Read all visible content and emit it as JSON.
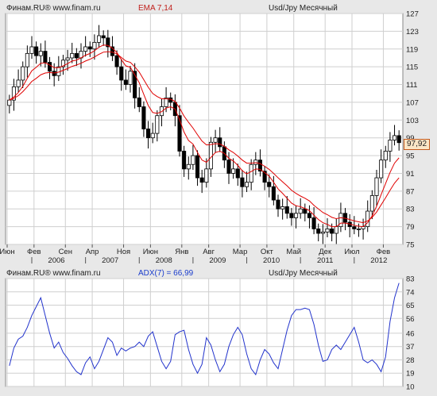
{
  "colors": {
    "background": "#e8e8e8",
    "plot_bg": "#ffffff",
    "grid": "#cfcfcf",
    "up_candle": "#ffffff",
    "down_candle": "#000000",
    "ema": "#e00000",
    "adx": "#2233cc",
    "price_tag_bg": "#fbe6c6",
    "price_tag_border": "#c25a1d"
  },
  "top_panel": {
    "source_label": "Финам.RU® www.finam.ru",
    "indicator_label": "EMA 7,14",
    "instrument_label": "Usd/Jpy Месячный",
    "last_price_label": "97,92"
  },
  "bottom_panel": {
    "source_label": "Финам.RU® www.finam.ru",
    "indicator_label": "ADX(7) = 66,99",
    "instrument_label": "Usd/Jpy Месячный"
  },
  "x_axis": {
    "month_labels": [
      "Июн",
      "Фев",
      "Сен",
      "Апр",
      "Ноя",
      "Июн",
      "Янв",
      "Авг",
      "Мар",
      "Окт",
      "Май",
      "Дек",
      "Июл",
      "Фев"
    ],
    "year_labels": [
      "2006",
      "2007",
      "2008",
      "2009",
      "2010",
      "2011",
      "2012"
    ]
  },
  "chart_data": [
    {
      "type": "candlestick",
      "title": "Usd/Jpy Месячный",
      "indicator": "EMA 7,14",
      "ylim": [
        75,
        127
      ],
      "y_ticks": [
        75,
        79,
        83,
        87,
        91,
        95,
        99,
        103,
        107,
        111,
        115,
        119,
        123,
        127
      ],
      "last_price": 97.92,
      "grid": true,
      "months": [
        "Июн",
        "Фев",
        "Сен",
        "Апр",
        "Ноя",
        "Июн",
        "Янв",
        "Авг",
        "Мар",
        "Окт",
        "Май",
        "Дек",
        "Июл",
        "Фев"
      ],
      "years": [
        "2006",
        "2007",
        "2008",
        "2009",
        "2010",
        "2011",
        "2012"
      ],
      "series": [
        {
          "name": "Usd/Jpy",
          "ohlc_close": [
            107.5,
            110.5,
            112,
            115,
            118,
            119.5,
            117.5,
            118.5,
            116,
            114,
            113,
            115,
            116.5,
            117,
            118,
            117,
            118.5,
            119.5,
            119,
            120.5,
            122,
            121.5,
            119.5,
            117.5,
            115,
            112,
            111,
            114,
            108,
            106,
            101,
            99,
            100,
            104,
            106,
            108,
            107,
            104,
            96,
            92,
            93,
            95,
            90,
            89,
            92,
            98,
            99,
            97,
            94,
            91,
            92,
            90,
            88,
            89,
            93,
            94,
            91.5,
            89,
            88,
            85,
            83,
            83.5,
            82,
            81,
            82,
            83,
            82,
            81,
            78.5,
            77.5,
            77.8,
            78.5,
            77.5,
            79,
            82,
            80,
            79,
            78.5,
            78.5,
            79,
            82.5,
            86,
            90,
            94,
            96,
            98.5,
            99.5,
            97.92
          ]
        },
        {
          "name": "EMA 7",
          "values": [
            107.5,
            108.2,
            109.2,
            110.6,
            112.4,
            114.1,
            114.9,
            115.8,
            115.9,
            115.4,
            114.8,
            114.8,
            115.2,
            115.7,
            116.3,
            116.5,
            117,
            117.6,
            118,
            118.6,
            119.4,
            119.9,
            119.8,
            119.2,
            118.2,
            116.6,
            115.2,
            114.9,
            113.2,
            111.4,
            108.8,
            106.3,
            104.7,
            104.5,
            104.9,
            105.7,
            106,
            105.5,
            103.1,
            100.3,
            98.4,
            97.6,
            95.7,
            94,
            93.5,
            94.6,
            95.7,
            96,
            95.5,
            94.4,
            93.8,
            92.8,
            91.6,
            90.9,
            91.4,
            92,
            91.9,
            91.2,
            90.4,
            89,
            87.5,
            86.5,
            85.4,
            84.3,
            83.7,
            83.5,
            83.1,
            82.6,
            81.6,
            80.6,
            79.9,
            79.5,
            79,
            79,
            79.8,
            79.8,
            79.6,
            79.3,
            79.1,
            79,
            79.9,
            81.4,
            83.6,
            86.2,
            88.7,
            91.2,
            93.3,
            94.5
          ]
        },
        {
          "name": "EMA 14",
          "values": [
            107.5,
            107.9,
            108.5,
            109.4,
            110.5,
            111.7,
            112.4,
            113.2,
            113.6,
            113.7,
            113.6,
            113.8,
            114.2,
            114.6,
            115.1,
            115.4,
            115.8,
            116.3,
            116.7,
            117.2,
            117.8,
            118.3,
            118.4,
            118.3,
            117.9,
            117.1,
            116.3,
            116,
            115,
            113.8,
            112.1,
            110.4,
            109,
            108.3,
            107.8,
            107.8,
            107.7,
            107.2,
            105.7,
            103.9,
            102.5,
            101.2,
            99.7,
            98.3,
            97.4,
            97.5,
            97.7,
            97.6,
            97.1,
            96.3,
            95.7,
            94.9,
            94,
            93.3,
            93.3,
            93.4,
            93.2,
            92.6,
            91.9,
            91,
            90,
            89.1,
            88.2,
            87.2,
            86.5,
            85.9,
            85.4,
            84.8,
            83.8,
            83,
            82.2,
            81.7,
            81.1,
            80.8,
            81,
            80.9,
            80.6,
            80.3,
            80.1,
            79.9,
            80.3,
            81.1,
            82.3,
            83.9,
            85.5,
            87.2,
            88.8,
            90
          ]
        }
      ]
    },
    {
      "type": "line",
      "title": "Usd/Jpy Месячный",
      "indicator": "ADX(7) = 66,99",
      "ylim": [
        10,
        83
      ],
      "y_ticks": [
        10,
        19,
        28,
        37,
        46,
        56,
        65,
        74,
        83
      ],
      "grid": true,
      "months": [
        "Июн",
        "Фев",
        "Сен",
        "Апр",
        "Ноя",
        "Июн",
        "Янв",
        "Авг",
        "Мар",
        "Окт",
        "Май",
        "Дек",
        "Июл",
        "Фев"
      ],
      "years": [
        "2006",
        "2007",
        "2008",
        "2009",
        "2010",
        "2011",
        "2012"
      ],
      "series": [
        {
          "name": "ADX(7)",
          "values": [
            24,
            36,
            42,
            44,
            50,
            58,
            64,
            70,
            58,
            46,
            36,
            40,
            33,
            29,
            24,
            20,
            18,
            26,
            30,
            22,
            27,
            35,
            43,
            40,
            31,
            36,
            34,
            36,
            37,
            40,
            37,
            44,
            47,
            37,
            27,
            22,
            27,
            45,
            47,
            48,
            35,
            25,
            19,
            25,
            43,
            38,
            28,
            20,
            25,
            37,
            45,
            50,
            45,
            32,
            22,
            18,
            28,
            35,
            32,
            26,
            22,
            35,
            48,
            58,
            62,
            62,
            63,
            62,
            52,
            38,
            27,
            28,
            35,
            38,
            35,
            40,
            45,
            50,
            40,
            28,
            26,
            28,
            25,
            20,
            30,
            54,
            70,
            80
          ]
        }
      ]
    }
  ]
}
